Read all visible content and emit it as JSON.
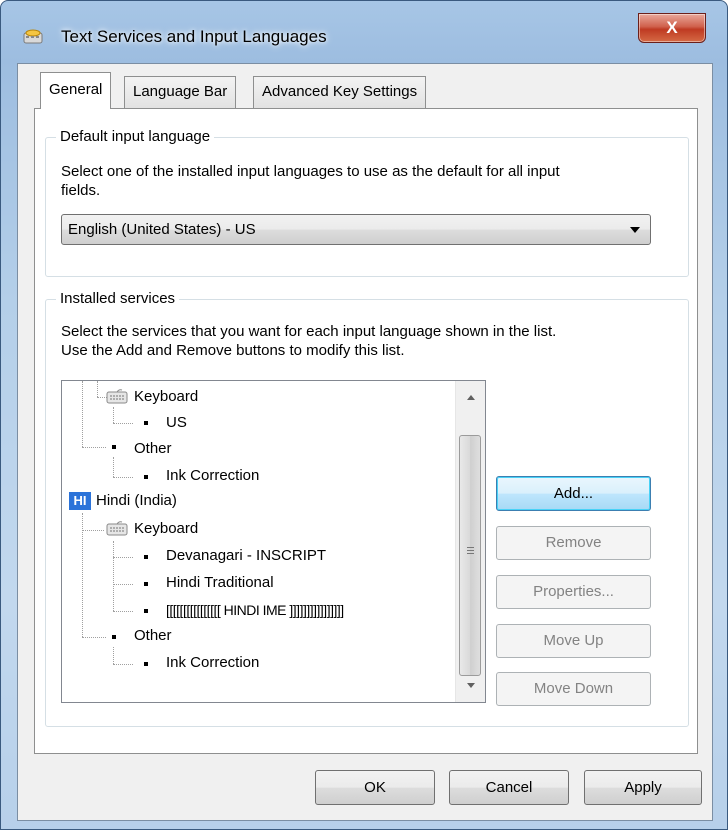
{
  "window": {
    "title": "Text Services and Input Languages",
    "close_label": "X"
  },
  "tabs": [
    {
      "label": "General",
      "selected": true
    },
    {
      "label": "Language Bar",
      "selected": false
    },
    {
      "label": "Advanced Key Settings",
      "selected": false
    }
  ],
  "default_input": {
    "group_label": "Default input language",
    "description_line1": "Select one of the installed input languages to use as the default for all input",
    "description_line2": "fields.",
    "selected_value": "English (United States) - US"
  },
  "installed_services": {
    "group_label": "Installed services",
    "description_line1": "Select the services that you want for each input language shown in the list.",
    "description_line2": "Use the Add and Remove buttons to modify this list.",
    "tree": {
      "keyboard1": "Keyboard",
      "us": "US",
      "other1": "Other",
      "ink1": "Ink Correction",
      "hindi_badge": "HI",
      "hindi": "Hindi (India)",
      "keyboard2": "Keyboard",
      "devanagari": "Devanagari - INSCRIPT",
      "hindi_traditional": "Hindi Traditional",
      "hindi_ime": "[[[[[[[[[[[[[[[[ HINDI IME ]]]]]]]]]]]]]]]]",
      "other2": "Other",
      "ink2": "Ink Correction"
    },
    "buttons": {
      "add": "Add...",
      "remove": "Remove",
      "properties": "Properties...",
      "move_up": "Move Up",
      "move_down": "Move Down"
    }
  },
  "footer": {
    "ok": "OK",
    "cancel": "Cancel",
    "apply": "Apply"
  },
  "colors": {
    "accent": "#2b73d9",
    "close_button": "#c9452d"
  }
}
